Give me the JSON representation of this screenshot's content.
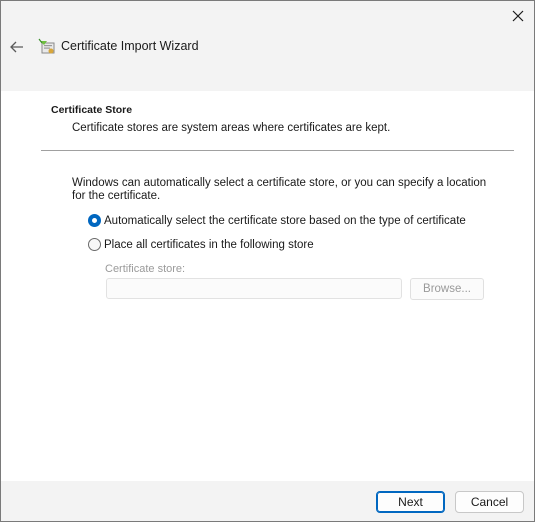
{
  "window": {
    "close_glyph": "✕"
  },
  "header": {
    "back_glyph": "←",
    "title": "Certificate Import Wizard",
    "icon": "certificate-wizard-icon"
  },
  "page": {
    "section_title": "Certificate Store",
    "section_subtitle": "Certificate stores are system areas where certificates are kept.",
    "description": "Windows can automatically select a certificate store, or you can specify a location for the certificate.",
    "options": [
      {
        "label": "Automatically select the certificate store based on the type of certificate",
        "selected": true
      },
      {
        "label": "Place all certificates in the following store",
        "selected": false
      }
    ],
    "store_label": "Certificate store:",
    "store_value": "",
    "browse_label": "Browse..."
  },
  "footer": {
    "next_label": "Next",
    "cancel_label": "Cancel"
  },
  "colors": {
    "accent": "#0067c0",
    "content_bg": "#ffffff",
    "chrome_bg": "#f3f3f3",
    "disabled_text": "#9a9a9a"
  }
}
